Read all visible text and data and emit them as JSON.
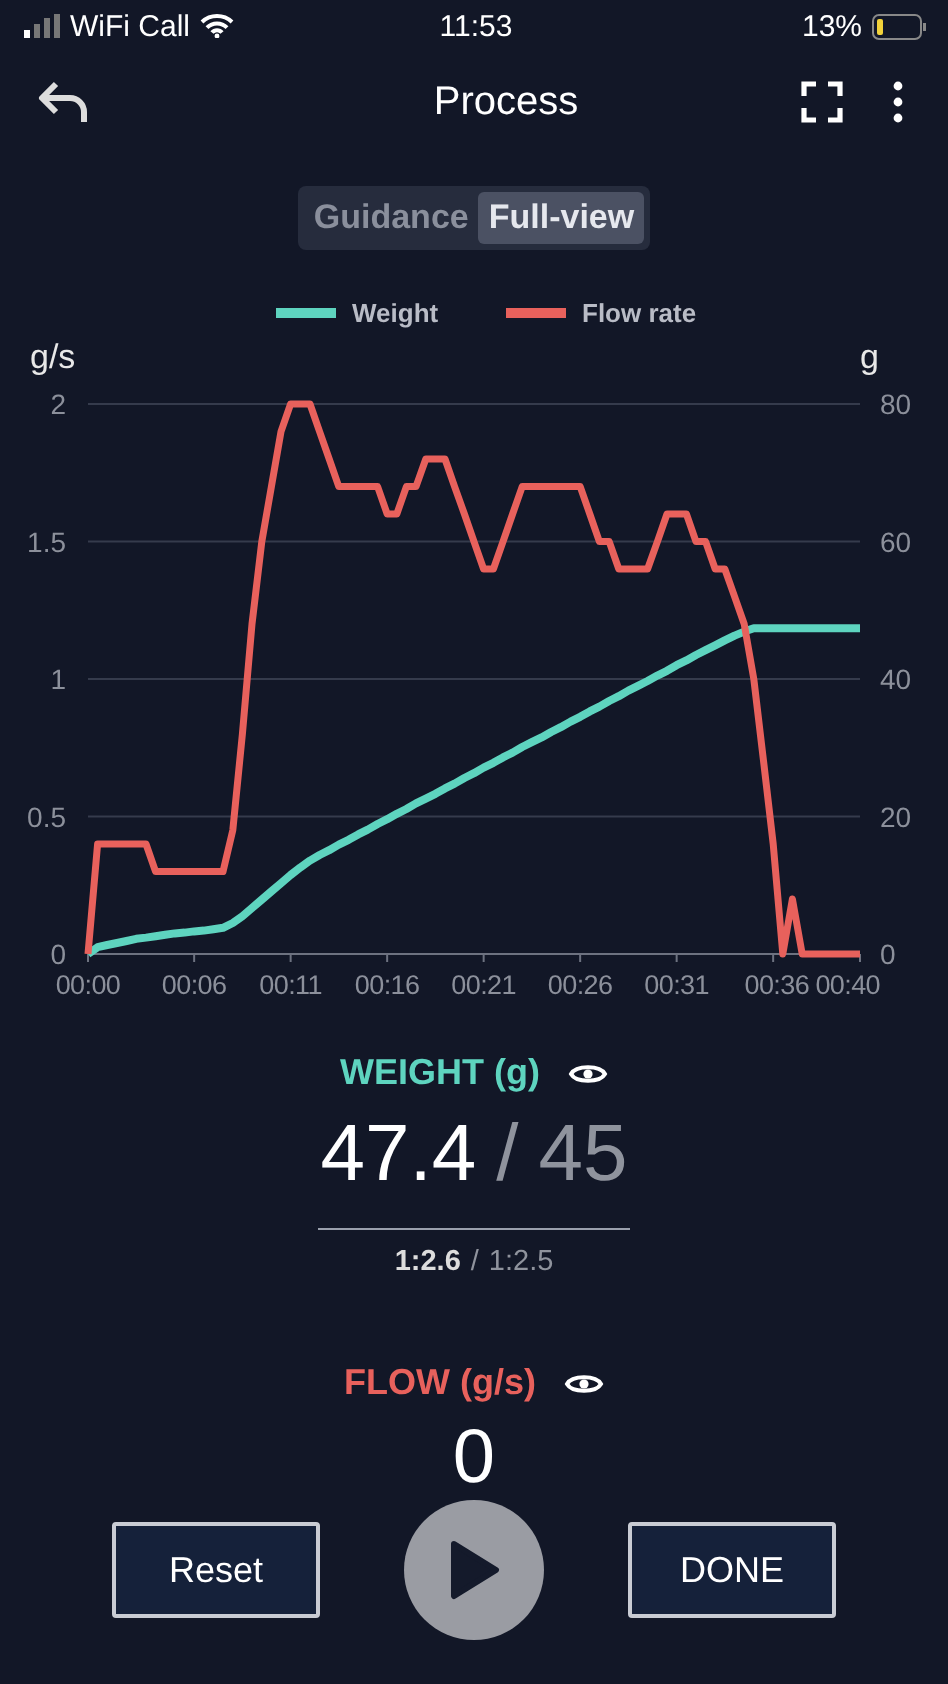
{
  "status_bar": {
    "carrier": "WiFi Call",
    "time": "11:53",
    "battery": "13%"
  },
  "header": {
    "title": "Process"
  },
  "tabs": [
    {
      "label": "Guidance",
      "selected": false
    },
    {
      "label": "Full-view",
      "selected": true
    }
  ],
  "chart_data": {
    "type": "line",
    "grid": true,
    "legend": "top",
    "ylabel": "g/s",
    "y2label": "g",
    "xlim": [
      0,
      40
    ],
    "ylim": [
      0,
      2
    ],
    "y2lim": [
      0,
      80
    ],
    "xticks": [
      {
        "value": 0,
        "label": "00:00"
      },
      {
        "value": 5.5,
        "label": "00:06"
      },
      {
        "value": 10.5,
        "label": "00:11"
      },
      {
        "value": 15.5,
        "label": "00:16"
      },
      {
        "value": 20.5,
        "label": "00:21"
      },
      {
        "value": 25.5,
        "label": "00:26"
      },
      {
        "value": 30.5,
        "label": "00:31"
      },
      {
        "value": 35.5,
        "label": "00:36"
      },
      {
        "value": 40,
        "label": "00:40"
      }
    ],
    "yticks": [
      {
        "value": 0,
        "label": "0"
      },
      {
        "value": 0.5,
        "label": "0.5"
      },
      {
        "value": 1,
        "label": "1"
      },
      {
        "value": 1.5,
        "label": "1.5"
      },
      {
        "value": 2,
        "label": "2"
      }
    ],
    "y2ticks": [
      {
        "value": 0,
        "label": "0"
      },
      {
        "value": 20,
        "label": "20"
      },
      {
        "value": 40,
        "label": "40"
      },
      {
        "value": 60,
        "label": "60"
      },
      {
        "value": 80,
        "label": "80"
      }
    ],
    "x": [
      0,
      0.5,
      1,
      1.5,
      2,
      2.5,
      3,
      3.5,
      4,
      4.5,
      5,
      5.5,
      6,
      6.5,
      7,
      7.5,
      8,
      8.5,
      9,
      9.5,
      10,
      10.5,
      11,
      11.5,
      12,
      12.5,
      13,
      13.5,
      14,
      14.5,
      15,
      15.5,
      16,
      16.5,
      17,
      17.5,
      18,
      18.5,
      19,
      19.5,
      20,
      20.5,
      21,
      21.5,
      22,
      22.5,
      23,
      23.5,
      24,
      24.5,
      25,
      25.5,
      26,
      26.5,
      27,
      27.5,
      28,
      28.5,
      29,
      29.5,
      30,
      30.5,
      31,
      31.5,
      32,
      32.5,
      33,
      33.5,
      34,
      34.5,
      35,
      35.5,
      36,
      36.5,
      37,
      37.5,
      38,
      38.5,
      39,
      39.5,
      40
    ],
    "series": [
      {
        "name": "Weight",
        "color": "#5ed4bf",
        "axis": "y2",
        "values": [
          0,
          1,
          1.3,
          1.6,
          1.9,
          2.2,
          2.4,
          2.6,
          2.8,
          3,
          3.1,
          3.3,
          3.4,
          3.6,
          3.8,
          4.5,
          5.5,
          6.7,
          7.9,
          9.1,
          10.3,
          11.5,
          12.6,
          13.6,
          14.4,
          15.1,
          15.9,
          16.6,
          17.4,
          18.1,
          18.9,
          19.6,
          20.4,
          21.1,
          21.9,
          22.6,
          23.3,
          24.1,
          24.8,
          25.6,
          26.3,
          27.1,
          27.8,
          28.6,
          29.3,
          30.1,
          30.8,
          31.5,
          32.3,
          33,
          33.8,
          34.5,
          35.3,
          36,
          36.8,
          37.5,
          38.3,
          39,
          39.7,
          40.5,
          41.2,
          42,
          42.7,
          43.5,
          44.2,
          44.9,
          45.6,
          46.3,
          46.9,
          47.4,
          47.4,
          47.4,
          47.4,
          47.4,
          47.4,
          47.4,
          47.4,
          47.4,
          47.4,
          47.4,
          47.4
        ]
      },
      {
        "name": "Flow rate",
        "color": "#e8615c",
        "values": [
          0,
          0.4,
          0.4,
          0.4,
          0.4,
          0.4,
          0.4,
          0.3,
          0.3,
          0.3,
          0.3,
          0.3,
          0.3,
          0.3,
          0.3,
          0.45,
          0.8,
          1.2,
          1.5,
          1.7,
          1.9,
          2,
          2,
          2,
          1.9,
          1.8,
          1.7,
          1.7,
          1.7,
          1.7,
          1.7,
          1.6,
          1.6,
          1.7,
          1.7,
          1.8,
          1.8,
          1.8,
          1.7,
          1.6,
          1.5,
          1.4,
          1.4,
          1.5,
          1.6,
          1.7,
          1.7,
          1.7,
          1.7,
          1.7,
          1.7,
          1.7,
          1.6,
          1.5,
          1.5,
          1.4,
          1.4,
          1.4,
          1.4,
          1.5,
          1.6,
          1.6,
          1.6,
          1.5,
          1.5,
          1.4,
          1.4,
          1.3,
          1.2,
          1,
          0.7,
          0.4,
          0,
          0.2,
          0,
          0,
          0,
          0,
          0,
          0,
          0
        ]
      }
    ]
  },
  "weight": {
    "label": "WEIGHT (g)",
    "value": "47.4",
    "separator": "/",
    "target": "45",
    "ratio": "1:2.6",
    "ratio_separator": "/",
    "ratio_target": "1:2.5"
  },
  "flow": {
    "label": "FLOW (g/s)",
    "value": "0"
  },
  "buttons": {
    "reset": "Reset",
    "done": "DONE"
  }
}
